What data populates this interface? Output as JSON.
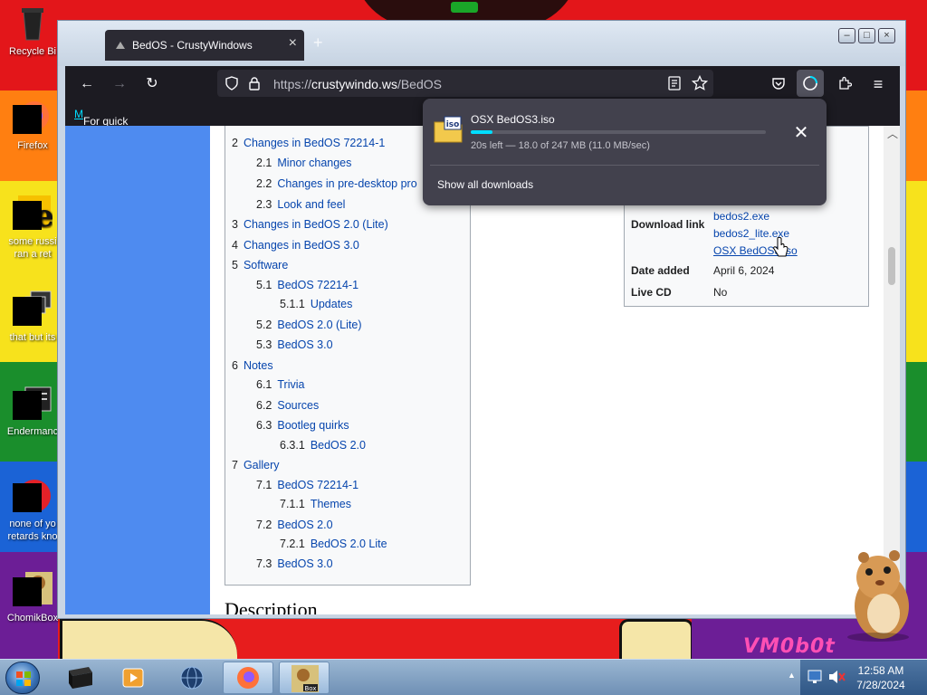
{
  "desktop": {
    "icons": [
      {
        "label": "Recycle Bi"
      },
      {
        "label": "Firefox"
      },
      {
        "label": "some russi",
        "label2": "ran a ret"
      },
      {
        "label": "that but its"
      },
      {
        "label": "Endermanc"
      },
      {
        "label": "none of yo",
        "label2": "retards kno"
      },
      {
        "label": "ChomikBox"
      }
    ],
    "wallpaper_watermark": "VM0b0t"
  },
  "browser": {
    "tab_title": "BedOS - CrustyWindows",
    "url_prefix": "https://",
    "url_host": "crustywindo.ws",
    "url_path": "/BedOS",
    "bookmarks_bar_text": "For quick access, place your bookmarks here on the bookmarks toolbar.",
    "bookmarks_bar_link": "M"
  },
  "toc": [
    {
      "num": "2",
      "text": "Changes in BedOS 72214-1"
    },
    {
      "num": "2.1",
      "text": "Minor changes"
    },
    {
      "num": "2.2",
      "text": "Changes in pre-desktop pro"
    },
    {
      "num": "2.3",
      "text": "Look and feel"
    },
    {
      "num": "3",
      "text": "Changes in BedOS 2.0 (Lite)"
    },
    {
      "num": "4",
      "text": "Changes in BedOS 3.0"
    },
    {
      "num": "5",
      "text": "Software"
    },
    {
      "num": "5.1",
      "text": "BedOS 72214-1"
    },
    {
      "num": "5.1.1",
      "text": "Updates"
    },
    {
      "num": "5.2",
      "text": "BedOS 2.0 (Lite)"
    },
    {
      "num": "5.3",
      "text": "BedOS 3.0"
    },
    {
      "num": "6",
      "text": "Notes"
    },
    {
      "num": "6.1",
      "text": "Trivia"
    },
    {
      "num": "6.2",
      "text": "Sources"
    },
    {
      "num": "6.3",
      "text": "Bootleg quirks"
    },
    {
      "num": "6.3.1",
      "text": "BedOS 2.0"
    },
    {
      "num": "7",
      "text": "Gallery"
    },
    {
      "num": "7.1",
      "text": "BedOS 72214-1"
    },
    {
      "num": "7.1.1",
      "text": "Themes"
    },
    {
      "num": "7.2",
      "text": "BedOS 2.0"
    },
    {
      "num": "7.2.1",
      "text": "BedOS 2.0 Lite"
    },
    {
      "num": "7.3",
      "text": "BedOS 3.0"
    }
  ],
  "page": {
    "section_heading": "Description"
  },
  "infobox": {
    "download_label": "Download link",
    "links": [
      "bedos2.exe",
      "bedos2_lite.exe",
      "OSX BedOS3.iso"
    ],
    "date_label": "Date added",
    "date_value": "April 6, 2024",
    "livecd_label": "Live CD",
    "livecd_value": "No"
  },
  "downloads": {
    "file_name": "OSX BedOS3.iso",
    "status": "20s left — 18.0 of 247 MB (11.0 MB/sec)",
    "progress": 0.073,
    "show_all": "Show all downloads",
    "file_type": "iso"
  },
  "taskbar": {
    "time": "12:58 AM",
    "date": "7/28/2024",
    "chomik_label": "Box"
  }
}
